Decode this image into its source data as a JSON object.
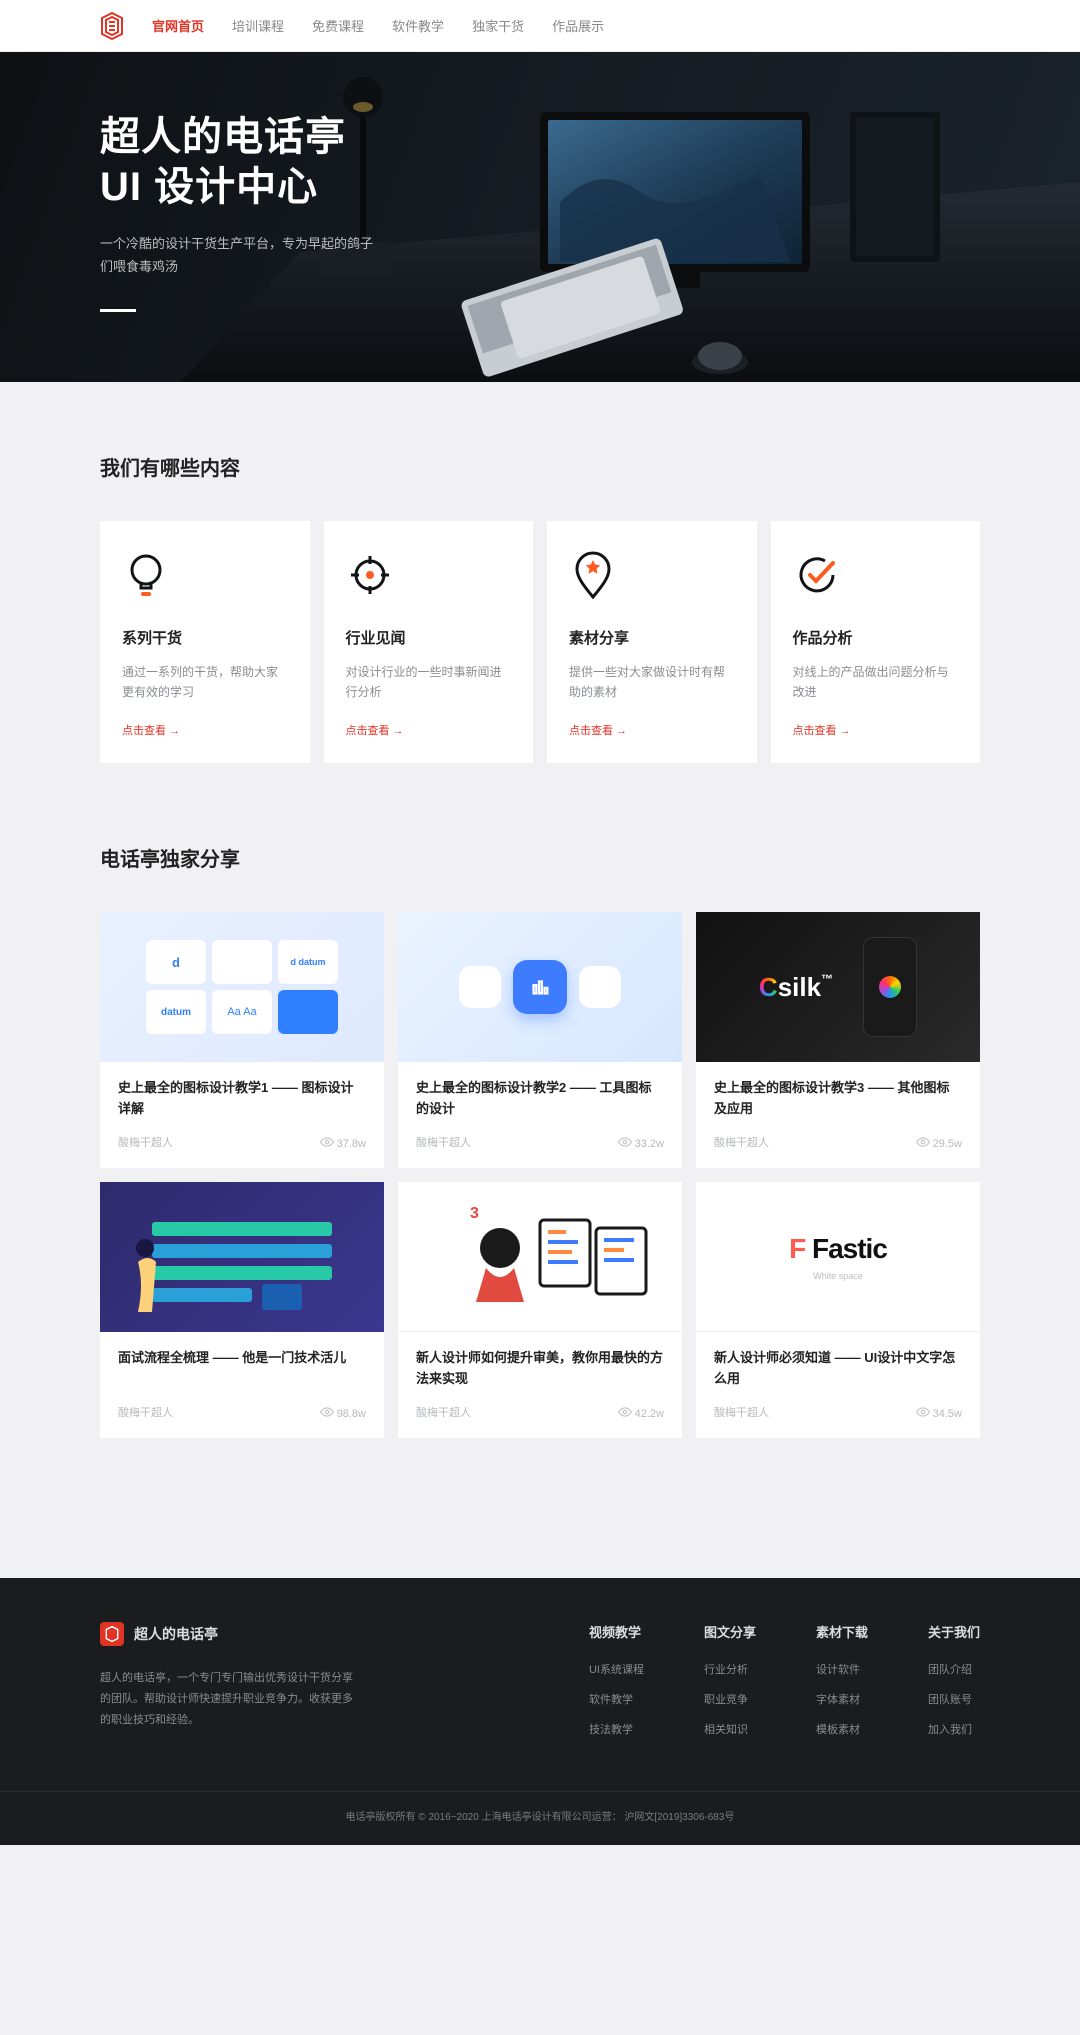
{
  "nav": {
    "items": [
      "官网首页",
      "培训课程",
      "免费课程",
      "软件教学",
      "独家干货",
      "作品展示"
    ],
    "active_index": 0
  },
  "hero": {
    "title_line1": "超人的电话亭",
    "title_line2": "UI 设计中心",
    "subtitle": "一个冷酷的设计干货生产平台，专为早起的鸽子们喂食毒鸡汤"
  },
  "section_features": {
    "heading": "我们有哪些内容",
    "link_label": "点击查看 →",
    "items": [
      {
        "name": "系列干货",
        "desc": "通过一系列的干货，帮助大家更有效的学习"
      },
      {
        "name": "行业见闻",
        "desc": "对设计行业的一些时事新闻进行分析"
      },
      {
        "name": "素材分享",
        "desc": "提供一些对大家做设计时有帮助的素材"
      },
      {
        "name": "作品分析",
        "desc": "对线上的产品做出问题分析与改进"
      }
    ]
  },
  "section_articles": {
    "heading": "电话亭独家分享",
    "author": "酸梅干超人",
    "items": [
      {
        "title": "史上最全的图标设计教学1 —— 图标设计详解",
        "views": "37.8w"
      },
      {
        "title": "史上最全的图标设计教学2 —— 工具图标的设计",
        "views": "33.2w"
      },
      {
        "title": "史上最全的图标设计教学3 —— 其他图标及应用",
        "views": "29.5w"
      },
      {
        "title": "面试流程全梳理 —— 他是一门技术活儿",
        "views": "98.8w"
      },
      {
        "title": "新人设计师如何提升审美，教你用最快的方法来实现",
        "views": "42.2w"
      },
      {
        "title": "新人设计师必须知道 —— UI设计中文字怎么用",
        "views": "34.5w"
      }
    ]
  },
  "footer": {
    "brand_name": "超人的电话亭",
    "brand_desc": "超人的电话亭，一个专门专门输出优秀设计干货分享的团队。帮助设计师快速提升职业竞争力。收获更多的职业技巧和经验。",
    "cols": [
      {
        "h": "视频教学",
        "items": [
          "UI系统课程",
          "软件教学",
          "技法教学"
        ]
      },
      {
        "h": "图文分享",
        "items": [
          "行业分析",
          "职业竞争",
          "相关知识"
        ]
      },
      {
        "h": "素材下载",
        "items": [
          "设计软件",
          "字体素材",
          "模板素材"
        ]
      },
      {
        "h": "关于我们",
        "items": [
          "团队介绍",
          "团队账号",
          "加入我们"
        ]
      }
    ],
    "copyright": "电话亭版权所有 © 2016~2020 上海电话亭设计有限公司运营：  沪网文[2019]3306-683号"
  }
}
